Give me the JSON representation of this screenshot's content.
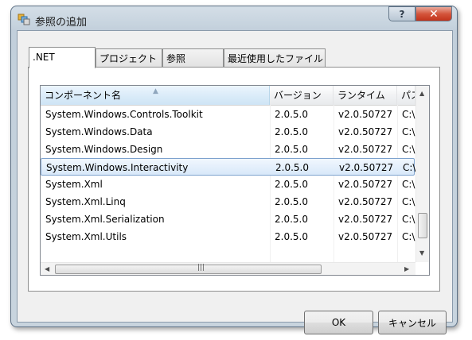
{
  "window": {
    "title": "参照の追加",
    "help_glyph": "?",
    "close_glyph": "✕"
  },
  "tabs": [
    {
      "label": ".NET",
      "active": true
    },
    {
      "label": "プロジェクト",
      "active": false
    },
    {
      "label": "参照",
      "active": false
    },
    {
      "label": "最近使用したファイル",
      "active": false
    }
  ],
  "list": {
    "columns": [
      "コンポーネント名",
      "バージョン",
      "ランタイム",
      "パス"
    ],
    "sort_glyph": "▲",
    "rows": [
      {
        "name": "System.Windows.Controls.Toolkit",
        "version": "2.0.5.0",
        "runtime": "v2.0.50727",
        "path": "C:\\"
      },
      {
        "name": "System.Windows.Data",
        "version": "2.0.5.0",
        "runtime": "v2.0.50727",
        "path": "C:\\"
      },
      {
        "name": "System.Windows.Design",
        "version": "2.0.5.0",
        "runtime": "v2.0.50727",
        "path": "C:\\"
      },
      {
        "name": "System.Windows.Interactivity",
        "version": "2.0.5.0",
        "runtime": "v2.0.50727",
        "path": "C:\\",
        "selected": true
      },
      {
        "name": "System.Xml",
        "version": "2.0.5.0",
        "runtime": "v2.0.50727",
        "path": "C:\\"
      },
      {
        "name": "System.Xml.Linq",
        "version": "2.0.5.0",
        "runtime": "v2.0.50727",
        "path": "C:\\"
      },
      {
        "name": "System.Xml.Serialization",
        "version": "2.0.5.0",
        "runtime": "v2.0.50727",
        "path": "C:\\"
      },
      {
        "name": "System.Xml.Utils",
        "version": "2.0.5.0",
        "runtime": "v2.0.50727",
        "path": "C:\\"
      }
    ],
    "scroll_up": "▲",
    "scroll_down": "▼",
    "scroll_left": "◀",
    "scroll_right": "▶",
    "grip": "|||"
  },
  "buttons": {
    "ok": "OK",
    "cancel": "キャンセル"
  },
  "icons": {
    "title": "add-reference-icon",
    "cursor": "mouse-pointer-icon"
  },
  "colors": {
    "selection_border": "#7da2ce",
    "close_button": "#c2331b",
    "sorted_header": "#dbecf9"
  }
}
